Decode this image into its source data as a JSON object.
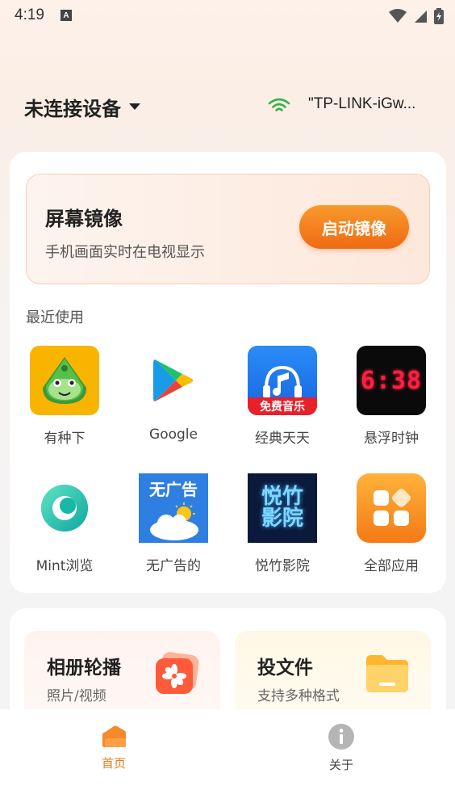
{
  "status_bar": {
    "time": "4:19",
    "indicator": "A"
  },
  "header": {
    "device_status": "未连接设备",
    "wifi_name": "\"TP-LINK-iGw..."
  },
  "mirror": {
    "title": "屏幕镜像",
    "subtitle": "手机画面实时在电视显示",
    "button": "启动镜像"
  },
  "recent": {
    "label": "最近使用",
    "apps": [
      {
        "label": "有种下",
        "icon": "frog-icon"
      },
      {
        "label": "Google",
        "icon": "google-play-icon"
      },
      {
        "label": "经典天天",
        "icon": "music-icon",
        "badge": "免费音乐"
      },
      {
        "label": "悬浮时钟",
        "icon": "clock-icon",
        "clock_text": "6:38"
      },
      {
        "label": "Mint浏览",
        "icon": "mint-browser-icon"
      },
      {
        "label": "无广告的",
        "icon": "weather-icon",
        "banner": "无广告"
      },
      {
        "label": "悦竹影院",
        "icon": "cinema-icon",
        "line1": "悦竹",
        "line2": "影院"
      },
      {
        "label": "全部应用",
        "icon": "all-apps-icon"
      }
    ]
  },
  "features": [
    {
      "title": "相册轮播",
      "subtitle": "照片/视频",
      "icon": "gallery-icon"
    },
    {
      "title": "投文件",
      "subtitle": "支持多种格式",
      "icon": "folder-icon"
    }
  ],
  "nav": [
    {
      "label": "首页",
      "icon": "home-icon",
      "active": true
    },
    {
      "label": "关于",
      "icon": "info-icon",
      "active": false
    }
  ],
  "colors": {
    "accent": "#f07a1a",
    "wifi": "#33b34a",
    "inactive": "#444444"
  }
}
